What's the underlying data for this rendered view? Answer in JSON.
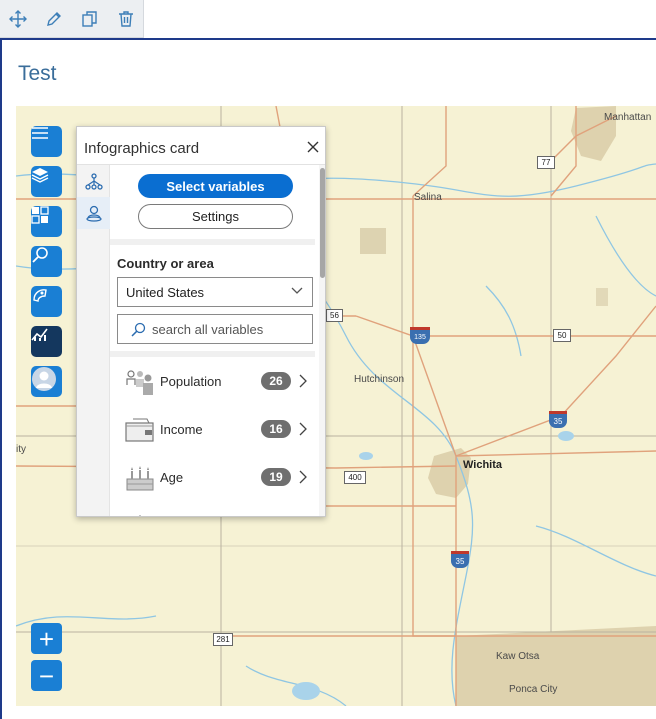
{
  "toolbar": {
    "icons": [
      "move-icon",
      "edit-icon",
      "duplicate-icon",
      "delete-icon"
    ]
  },
  "page": {
    "title": "Test"
  },
  "map": {
    "labels": {
      "manhattan": "Manhattan",
      "salina": "Salina",
      "hutchinson": "Hutchinson",
      "wichita": "Wichita",
      "kaw_otsa": "Kaw Otsa",
      "ponca_city": "Ponca City",
      "city_partial": "ity"
    },
    "shields": {
      "us77": "77",
      "us56": "56",
      "i135": "135",
      "us50": "50",
      "i35_north": "35",
      "us400": "400",
      "i35_south": "35",
      "us281": "281"
    },
    "tools": [
      "menu-icon",
      "layers-icon",
      "basemap-icon",
      "search-icon",
      "measure-icon",
      "infographics-icon",
      "profile-icon"
    ],
    "zoom_in": "+",
    "zoom_out": "−"
  },
  "card": {
    "title": "Infographics card",
    "select_variables": "Select variables",
    "settings": "Settings",
    "country_label": "Country or area",
    "country_value": "United States",
    "search_placeholder": "search all variables",
    "variables": [
      {
        "label": "Population",
        "count": "26",
        "icon": "population-icon"
      },
      {
        "label": "Income",
        "count": "16",
        "icon": "income-icon"
      },
      {
        "label": "Age",
        "count": "19",
        "icon": "age-icon"
      }
    ]
  },
  "colors": {
    "accent": "#1a7fd4",
    "primary_button": "#0a6ed1",
    "active_tool": "#14375e",
    "map_bg": "#f6f2d4",
    "road": "#e0a27c",
    "water": "#8fc6e3",
    "urban": "#d8cca8",
    "badge": "#6f6f6f"
  }
}
